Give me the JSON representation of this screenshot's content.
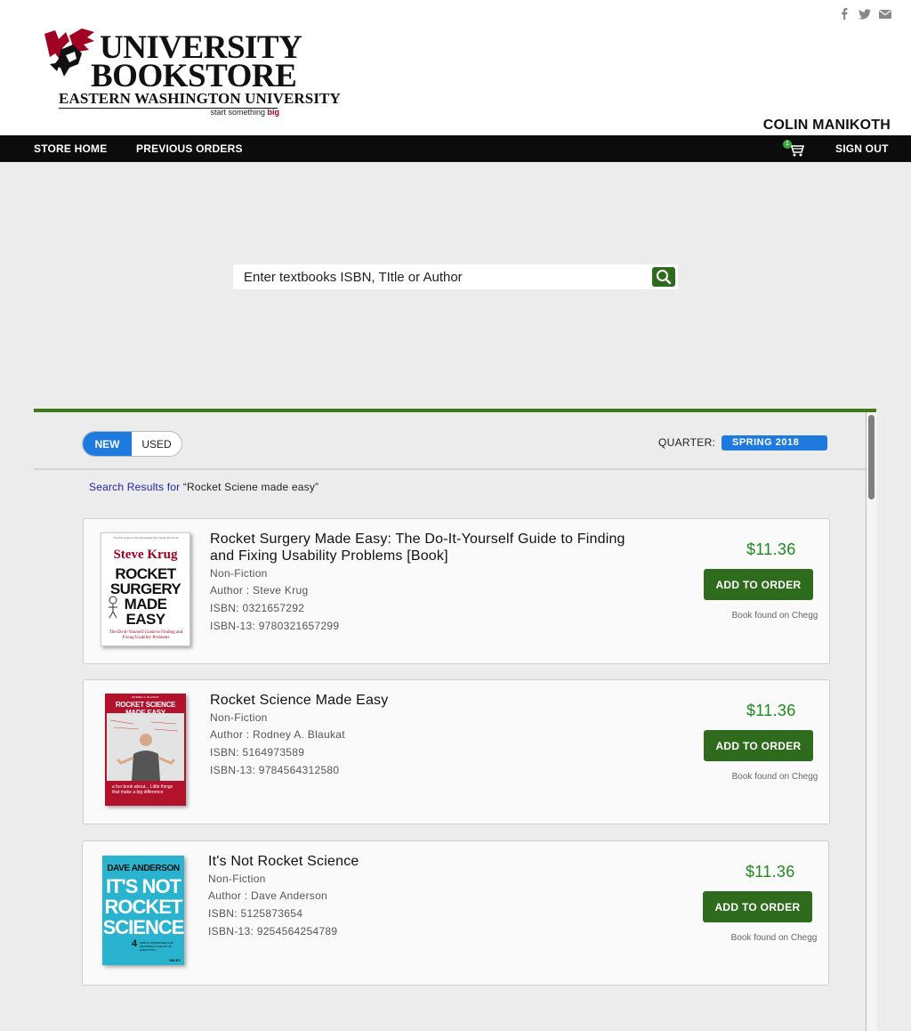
{
  "header": {
    "logo": {
      "line1": "UNIVERSITY",
      "line2": "BOOKSTORE",
      "line3": "EASTERN WASHINGTON UNIVERSITY",
      "tagline_prefix": "start something",
      "tagline_emph": "big"
    },
    "social_icons": [
      "facebook-icon",
      "twitter-icon",
      "mail-icon"
    ],
    "user_name": "COLIN MANIKOTH"
  },
  "nav": {
    "store_home": "STORE HOME",
    "previous_orders": "PREVIOUS ORDERS",
    "cart_count": "1",
    "sign_out": "SIGN OUT"
  },
  "search": {
    "placeholder": "Enter textbooks ISBN, TItle or Author"
  },
  "filters": {
    "new_label": "NEW",
    "used_label": "USED",
    "selected_condition": "NEW",
    "quarter_label": "QUARTER:",
    "quarter_value": "SPRING 2018"
  },
  "results": {
    "label": "Search Results for",
    "query": "“Rocket Sciene made easy”",
    "books": [
      {
        "title": "Rocket Surgery Made Easy: The Do-It-Yourself Guide to Finding and Fixing Usability Problems [Book]",
        "genre": "Non-Fiction",
        "author": "Author : Steve Krug",
        "isbn": "ISBN: 0321657292",
        "isbn13": "ISBN-13: 9780321657299",
        "price": "$11.36",
        "button": "ADD TO ORDER",
        "source": "Book found on Chegg",
        "cover": {
          "author": "Steve Krug",
          "blurb": "The first sequel to the bestselling Don't Make Me Think!",
          "lines": [
            "ROCKET",
            "SURGERY",
            "MADE",
            "EASY"
          ],
          "subtitle": "The Do-It-Yourself Guide to Finding and Fixing Usability Problems"
        }
      },
      {
        "title": "Rocket Science Made Easy",
        "genre": "Non-Fiction",
        "author": "Author : Rodney A. Blaukat",
        "isbn": "ISBN: 5164973589",
        "isbn13": "ISBN-13: 9784564312580",
        "price": "$11.36",
        "button": "ADD TO ORDER",
        "source": "Book found on Chegg",
        "cover": {
          "author": "RODNEY A. BLAUKAT",
          "title": "ROCKET SCIENCE MADE EASY",
          "blurb": "a fun book about... Little things that make a big difference"
        }
      },
      {
        "title": "It's Not Rocket Science",
        "genre": "Non-Fiction",
        "author": "Author : Dave Anderson",
        "isbn": "ISBN: 5125873654",
        "isbn13": "ISBN-13: 9254564254789",
        "price": "$11.36",
        "button": "ADD TO ORDER",
        "source": "Book found on Chegg",
        "cover": {
          "author": "DAVE ANDERSON",
          "lines": [
            "IT'S NOT",
            "ROCKET",
            "SCIENCE"
          ],
          "number": "4",
          "tagline": "SIMPLE STRATEGIES FOR MASTERING THE ART OF EXECUTION",
          "publisher": "WILEY"
        }
      }
    ]
  },
  "colors": {
    "accent_green": "#2f6b1c",
    "price_green": "#1e8a1e",
    "accent_blue": "#1f7ae0",
    "brand_red": "#a10022"
  }
}
